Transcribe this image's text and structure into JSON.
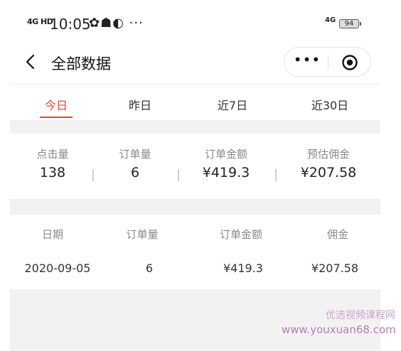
{
  "status_bar": {
    "signal_label": "4G HD",
    "time": "10:05",
    "notification_icons": "✿☗◐ ···",
    "network": "4G",
    "battery": "94"
  },
  "nav": {
    "title": "全部数据",
    "more_label": "•••"
  },
  "tabs": [
    {
      "label": "今日",
      "active": true
    },
    {
      "label": "昨日",
      "active": false
    },
    {
      "label": "近7日",
      "active": false
    },
    {
      "label": "近30日",
      "active": false
    }
  ],
  "summary": [
    {
      "label": "点击量",
      "value": "138"
    },
    {
      "label": "订单量",
      "value": "6"
    },
    {
      "label": "订单金额",
      "value": "¥419.3"
    },
    {
      "label": "预估佣金",
      "value": "¥207.58"
    }
  ],
  "table": {
    "headers": [
      "日期",
      "订单量",
      "订单金额",
      "佣金"
    ],
    "rows": [
      [
        "2020-09-05",
        "6",
        "¥419.3",
        "¥207.58"
      ]
    ]
  },
  "watermark": {
    "text": "优选视频课程网",
    "url": "www.youxuan68.com"
  },
  "colors": {
    "accent": "#e0493f",
    "band": "#f2f2f2"
  }
}
